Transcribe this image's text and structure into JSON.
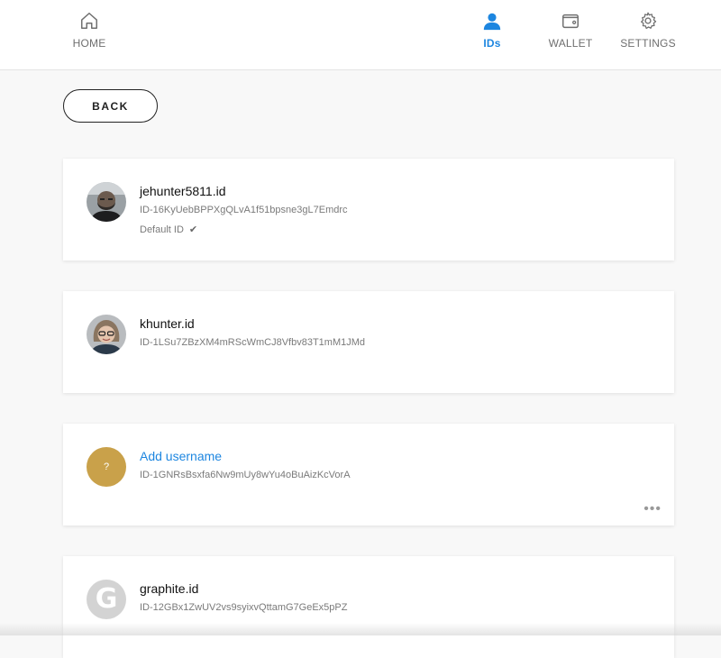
{
  "nav": {
    "items": [
      {
        "label": "HOME",
        "icon": "home-icon"
      },
      {
        "label": "IDs",
        "icon": "user-icon"
      },
      {
        "label": "WALLET",
        "icon": "wallet-icon"
      },
      {
        "label": "SETTINGS",
        "icon": "gear-icon"
      }
    ],
    "active": "IDs",
    "accent_color": "#1d86e0"
  },
  "back_button": {
    "label": "BACK"
  },
  "identities": [
    {
      "name": "jehunter5811.id",
      "id": "ID-16KyUebBPPXgQLvA1f51bpsne3gL7Emdrc",
      "default_label": "Default ID",
      "avatar": "photo-bearded-man"
    },
    {
      "name": "khunter.id",
      "id": "ID-1LSu7ZBzXM4mRScWmCJ8Vfbv83T1mM1JMd",
      "avatar": "photo-woman-glasses"
    },
    {
      "name": "Add username",
      "id": "ID-1GNRsBsxfa6Nw9mUy8wYu4oBuAizKcVorA",
      "avatar": "placeholder-question",
      "avatar_text": "?",
      "avatar_color": "#c9a14a"
    },
    {
      "name": "graphite.id",
      "id": "ID-12GBx1ZwUV2vs9syixvQttamG7GeEx5pPZ",
      "avatar": "graphite-logo",
      "avatar_text": "G"
    }
  ]
}
